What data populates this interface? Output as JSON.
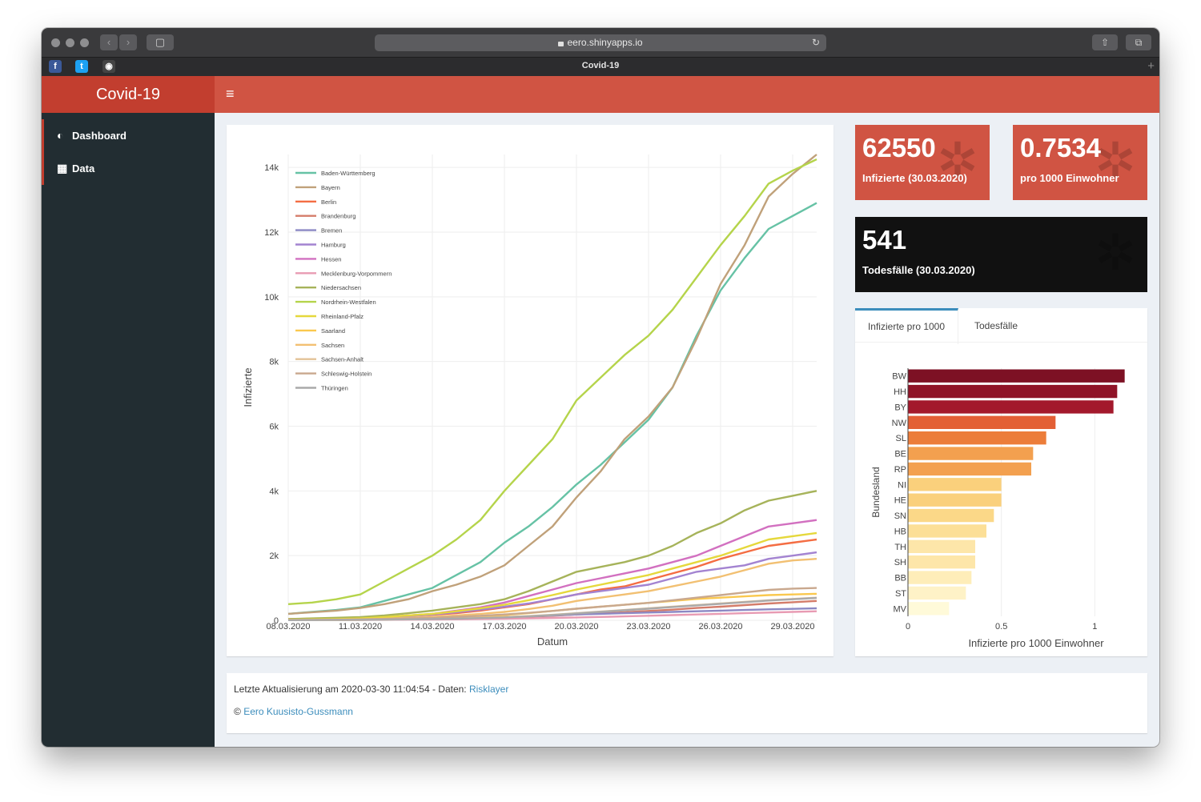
{
  "browser": {
    "url": "eero.shinyapps.io",
    "tab_title": "Covid-19",
    "back_glyph": "‹",
    "forward_glyph": "›",
    "sidebar_glyph": "▢",
    "share_glyph": "⇧",
    "tabs_glyph": "⧉",
    "reload_glyph": "↻",
    "new_tab_glyph": "+",
    "bookmarks": [
      {
        "name": "facebook-icon",
        "glyph": "f",
        "color": "#3b5998"
      },
      {
        "name": "twitter-icon",
        "glyph": "t",
        "color": "#1da1f2"
      },
      {
        "name": "github-icon",
        "glyph": "◉",
        "color": "#444444"
      }
    ]
  },
  "app": {
    "title": "Covid-19",
    "menu_glyph": "≡",
    "header_color": "#d05443",
    "logo_color": "#c23e2f",
    "sidebar_color": "#222d32"
  },
  "sidebar": {
    "items": [
      {
        "label": "Dashboard",
        "icon": "dashboard-icon",
        "glyph": "◐"
      },
      {
        "label": "Data",
        "icon": "table-icon",
        "glyph": "▦"
      }
    ]
  },
  "stats": {
    "infected": {
      "value": "62550",
      "label": "Infizierte (30.03.2020)",
      "color": "#d05443"
    },
    "per1000": {
      "value": "0.7534",
      "label": "pro 1000 Einwohner",
      "color": "#d05443"
    },
    "deaths": {
      "value": "541",
      "label": "Todesfälle (30.03.2020)",
      "color": "#111111"
    },
    "bug_glyph": "✲"
  },
  "tabs": {
    "items": [
      "Infizierte pro 1000",
      "Todesfälle"
    ],
    "active": 0
  },
  "footer": {
    "update_prefix": "Letzte Aktualisierung am 2020-03-30 11:04:54 - Daten: ",
    "source_link": "Risklayer",
    "copyright": "© ",
    "author_link": "Eero Kuusisto-Gussmann"
  },
  "chart_data": [
    {
      "type": "line",
      "xlabel": "Datum",
      "ylabel": "Infizierte",
      "ylim": [
        0,
        14400
      ],
      "yticks": [
        0,
        2000,
        4000,
        6000,
        8000,
        10000,
        12000,
        14000
      ],
      "ytick_labels": [
        "0",
        "2k",
        "4k",
        "6k",
        "8k",
        "10k",
        "12k",
        "14k"
      ],
      "xtick_labels": [
        "08.03.2020",
        "11.03.2020",
        "14.03.2020",
        "17.03.2020",
        "20.03.2020",
        "23.03.2020",
        "26.03.2020",
        "29.03.2020"
      ],
      "xtick_indices": [
        0,
        3,
        6,
        9,
        12,
        15,
        18,
        21
      ],
      "grid": true,
      "legend_position": "top-left",
      "dates": [
        "08.03.2020",
        "09.03.2020",
        "10.03.2020",
        "11.03.2020",
        "12.03.2020",
        "13.03.2020",
        "14.03.2020",
        "15.03.2020",
        "16.03.2020",
        "17.03.2020",
        "18.03.2020",
        "19.03.2020",
        "20.03.2020",
        "21.03.2020",
        "22.03.2020",
        "23.03.2020",
        "24.03.2020",
        "25.03.2020",
        "26.03.2020",
        "27.03.2020",
        "28.03.2020",
        "29.03.2020",
        "30.03.2020"
      ],
      "series": [
        {
          "name": "Baden-Württemberg",
          "color": "#66c2a5",
          "values": [
            200,
            260,
            320,
            400,
            600,
            800,
            1000,
            1400,
            1800,
            2400,
            2900,
            3500,
            4200,
            4800,
            5500,
            6200,
            7200,
            8800,
            10200,
            11200,
            12100,
            12500,
            12900
          ]
        },
        {
          "name": "Bayern",
          "color": "#c0a17a",
          "values": [
            200,
            250,
            300,
            380,
            500,
            650,
            900,
            1100,
            1350,
            1700,
            2300,
            2900,
            3800,
            4600,
            5600,
            6300,
            7200,
            8700,
            10400,
            11600,
            13100,
            13800,
            14400
          ]
        },
        {
          "name": "Berlin",
          "color": "#f46d43",
          "values": [
            40,
            50,
            60,
            80,
            100,
            130,
            170,
            220,
            300,
            400,
            500,
            650,
            800,
            950,
            1050,
            1250,
            1450,
            1650,
            1900,
            2100,
            2300,
            2400,
            2500
          ]
        },
        {
          "name": "Brandenburg",
          "color": "#d47c6a",
          "values": [
            5,
            8,
            10,
            15,
            20,
            30,
            40,
            50,
            70,
            90,
            110,
            140,
            180,
            210,
            250,
            290,
            330,
            380,
            420,
            470,
            520,
            560,
            600
          ]
        },
        {
          "name": "Bremen",
          "color": "#8c88c4",
          "values": [
            10,
            15,
            20,
            25,
            30,
            40,
            50,
            60,
            80,
            100,
            120,
            150,
            180,
            200,
            220,
            240,
            260,
            280,
            300,
            320,
            340,
            355,
            370
          ]
        },
        {
          "name": "Hamburg",
          "color": "#a383d1",
          "values": [
            20,
            30,
            40,
            60,
            90,
            130,
            180,
            250,
            330,
            420,
            520,
            650,
            800,
            900,
            1000,
            1100,
            1300,
            1500,
            1600,
            1700,
            1900,
            2000,
            2100
          ]
        },
        {
          "name": "Hessen",
          "color": "#d270c0",
          "values": [
            20,
            30,
            40,
            60,
            100,
            150,
            200,
            300,
            400,
            550,
            750,
            950,
            1150,
            1300,
            1450,
            1600,
            1800,
            2000,
            2300,
            2600,
            2900,
            3000,
            3100
          ]
        },
        {
          "name": "Mecklenburg-Vorpommern",
          "color": "#e89bb3",
          "values": [
            5,
            8,
            10,
            12,
            15,
            20,
            25,
            30,
            40,
            50,
            60,
            75,
            90,
            105,
            120,
            140,
            160,
            180,
            200,
            220,
            240,
            260,
            280
          ]
        },
        {
          "name": "Niedersachsen",
          "color": "#a6b35a",
          "values": [
            40,
            60,
            80,
            100,
            150,
            220,
            300,
            400,
            500,
            650,
            900,
            1200,
            1500,
            1650,
            1800,
            2000,
            2300,
            2700,
            3000,
            3400,
            3700,
            3850,
            4000
          ]
        },
        {
          "name": "Nordrhein-Westfalen",
          "color": "#b5d44b",
          "values": [
            500,
            550,
            650,
            800,
            1200,
            1600,
            2000,
            2500,
            3100,
            4000,
            4800,
            5600,
            6800,
            7500,
            8200,
            8800,
            9600,
            10600,
            11600,
            12500,
            13500,
            13900,
            14250
          ]
        },
        {
          "name": "Rheinland-Pfalz",
          "color": "#e5d83c",
          "values": [
            20,
            30,
            40,
            60,
            100,
            150,
            200,
            280,
            370,
            480,
            620,
            780,
            950,
            1100,
            1250,
            1400,
            1600,
            1800,
            2000,
            2250,
            2500,
            2600,
            2700
          ]
        },
        {
          "name": "Saarland",
          "color": "#fac84e",
          "values": [
            5,
            8,
            10,
            15,
            25,
            40,
            60,
            80,
            120,
            160,
            220,
            290,
            360,
            420,
            480,
            540,
            600,
            660,
            700,
            740,
            780,
            800,
            820
          ]
        },
        {
          "name": "Sachsen",
          "color": "#f2c072",
          "values": [
            10,
            15,
            20,
            30,
            50,
            80,
            110,
            150,
            200,
            260,
            350,
            450,
            600,
            700,
            800,
            900,
            1050,
            1200,
            1350,
            1550,
            1750,
            1850,
            1900
          ]
        },
        {
          "name": "Sachsen-Anhalt",
          "color": "#e3c297",
          "values": [
            5,
            8,
            10,
            15,
            25,
            35,
            45,
            60,
            80,
            100,
            130,
            170,
            220,
            270,
            320,
            370,
            420,
            470,
            520,
            570,
            620,
            660,
            700
          ]
        },
        {
          "name": "Schleswig-Holstein",
          "color": "#c9a88e",
          "values": [
            10,
            15,
            20,
            30,
            45,
            60,
            80,
            110,
            140,
            180,
            230,
            290,
            360,
            420,
            480,
            540,
            620,
            700,
            780,
            860,
            940,
            980,
            1000
          ]
        },
        {
          "name": "Thüringen",
          "color": "#aaaaaa",
          "values": [
            5,
            8,
            10,
            15,
            20,
            30,
            40,
            50,
            70,
            90,
            120,
            160,
            210,
            260,
            310,
            360,
            410,
            460,
            510,
            560,
            610,
            650,
            690
          ]
        }
      ]
    },
    {
      "type": "bar",
      "orientation": "horizontal",
      "xlabel": "Infizierte pro 1000 Einwohner",
      "ylabel": "Bundesland",
      "xlim": [
        0,
        1.2
      ],
      "xticks": [
        0,
        0.5,
        1
      ],
      "xtick_labels": [
        "0",
        "0.5",
        "1"
      ],
      "categories": [
        "BW",
        "HH",
        "BY",
        "NW",
        "SL",
        "BE",
        "RP",
        "NI",
        "HE",
        "SN",
        "HB",
        "TH",
        "SH",
        "BB",
        "ST",
        "MV"
      ],
      "values": [
        1.16,
        1.12,
        1.1,
        0.79,
        0.74,
        0.67,
        0.66,
        0.5,
        0.5,
        0.46,
        0.42,
        0.36,
        0.36,
        0.34,
        0.31,
        0.22
      ],
      "colors": [
        "#7d1124",
        "#8f1327",
        "#a3192c",
        "#e35f35",
        "#ec7d3a",
        "#f3a04f",
        "#f3a04f",
        "#fad07c",
        "#fad07c",
        "#fbd888",
        "#fcdf97",
        "#fde6a9",
        "#fde6a9",
        "#feedb9",
        "#fef2c7",
        "#fffad9"
      ]
    }
  ]
}
